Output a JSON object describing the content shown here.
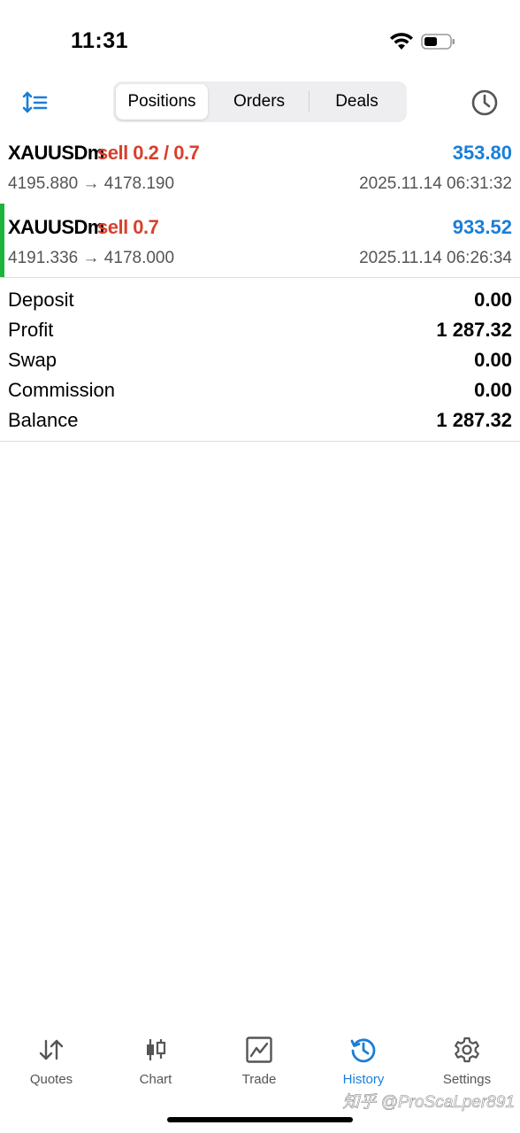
{
  "status_bar": {
    "time": "11:31"
  },
  "top_bar": {
    "tabs": [
      {
        "label": "Positions",
        "active": true
      },
      {
        "label": "Orders",
        "active": false
      },
      {
        "label": "Deals",
        "active": false
      }
    ]
  },
  "deals": [
    {
      "symbol": "XAUUSDm",
      "side": "sell 0.2 / 0.7",
      "profit": "353.80",
      "prices": "4195.880 → 4178.190",
      "time": "2025.11.14 06:31:32",
      "selected": false
    },
    {
      "symbol": "XAUUSDm",
      "side": "sell 0.7",
      "profit": "933.52",
      "prices": "4191.336 → 4178.000",
      "time": "2025.11.14 06:26:34",
      "selected": true
    }
  ],
  "summary": [
    {
      "label": "Deposit",
      "value": "0.00"
    },
    {
      "label": "Profit",
      "value": "1 287.32"
    },
    {
      "label": "Swap",
      "value": "0.00"
    },
    {
      "label": "Commission",
      "value": "0.00"
    },
    {
      "label": "Balance",
      "value": "1 287.32"
    }
  ],
  "tab_bar": [
    {
      "label": "Quotes",
      "icon": "quotes-icon",
      "active": false
    },
    {
      "label": "Chart",
      "icon": "chart-icon",
      "active": false
    },
    {
      "label": "Trade",
      "icon": "trade-icon",
      "active": false
    },
    {
      "label": "History",
      "icon": "history-icon",
      "active": true
    },
    {
      "label": "Settings",
      "icon": "settings-icon",
      "active": false
    }
  ],
  "watermark": "知乎 @ProScaLper891",
  "colors": {
    "accent_blue": "#1a7ed8",
    "sell_red": "#d8402c",
    "selected_green": "#1db33d"
  }
}
